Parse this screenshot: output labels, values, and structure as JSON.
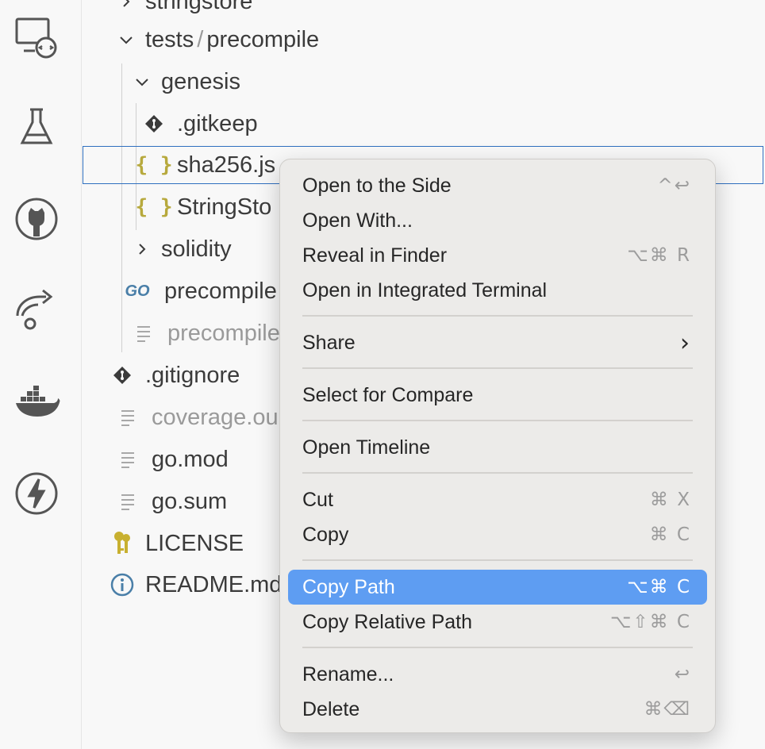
{
  "activity_bar": {
    "icons": [
      "remote-explorer-icon",
      "testing-flask-icon",
      "github-icon",
      "remote-share-icon",
      "docker-icon",
      "lightning-icon"
    ]
  },
  "explorer": {
    "items": [
      {
        "label": "stringstore",
        "icon": "chevron-right-icon"
      },
      {
        "label_a": "tests",
        "sep": "/",
        "label_b": "precompile",
        "icon": "chevron-down-icon"
      },
      {
        "label": "genesis",
        "icon": "chevron-down-icon"
      },
      {
        "label": ".gitkeep",
        "icon": "git-diamond-icon"
      },
      {
        "label": "sha256.js",
        "icon": "json-braces-icon"
      },
      {
        "label": "StringSto",
        "icon": "json-braces-icon"
      },
      {
        "label": "solidity",
        "icon": "chevron-right-icon"
      },
      {
        "label": "precompile",
        "icon": "go-icon",
        "icon_text": "GO"
      },
      {
        "label": "precompile",
        "icon": "text-file-icon"
      },
      {
        "label": ".gitignore",
        "icon": "git-diamond-icon"
      },
      {
        "label": "coverage.ou",
        "icon": "text-file-icon"
      },
      {
        "label": "go.mod",
        "icon": "text-file-icon"
      },
      {
        "label": "go.sum",
        "icon": "text-file-icon"
      },
      {
        "label": "LICENSE",
        "icon": "keys-icon"
      },
      {
        "label": "README.md",
        "icon": "info-icon"
      }
    ]
  },
  "context_menu": {
    "items": [
      {
        "label": "Open to the Side",
        "shortcut": "^↩"
      },
      {
        "label": "Open With...",
        "shortcut": ""
      },
      {
        "label": "Reveal in Finder",
        "shortcut": "⌥⌘ R"
      },
      {
        "label": "Open in Integrated Terminal",
        "shortcut": ""
      },
      {
        "label": "Share",
        "shortcut": "›"
      },
      {
        "label": "Select for Compare",
        "shortcut": ""
      },
      {
        "label": "Open Timeline",
        "shortcut": ""
      },
      {
        "label": "Cut",
        "shortcut": "⌘ X"
      },
      {
        "label": "Copy",
        "shortcut": "⌘ C"
      },
      {
        "label": "Copy Path",
        "shortcut": "⌥⌘ C"
      },
      {
        "label": "Copy Relative Path",
        "shortcut": "⌥⇧⌘ C"
      },
      {
        "label": "Rename...",
        "shortcut": "↩"
      },
      {
        "label": "Delete",
        "shortcut": "⌘⌫"
      }
    ],
    "highlight_color": "#5e9df2"
  }
}
